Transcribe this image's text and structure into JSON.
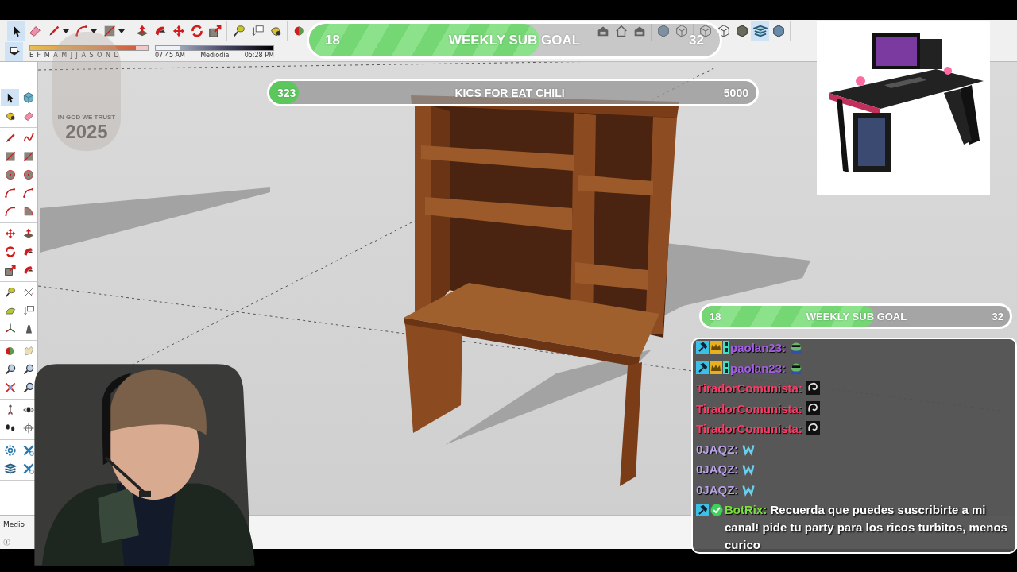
{
  "top_toolbar": {
    "left_groups": [
      {
        "tools": [
          {
            "kind": "select",
            "selected": true,
            "menu": false
          },
          {
            "kind": "eraser",
            "selected": false,
            "menu": false
          },
          {
            "kind": "pencil",
            "selected": false,
            "menu": true
          },
          {
            "kind": "arc",
            "selected": false,
            "menu": true
          },
          {
            "kind": "rectangle",
            "selected": false,
            "menu": true
          }
        ]
      },
      {
        "tools": [
          {
            "kind": "pushpull",
            "selected": false,
            "menu": false
          },
          {
            "kind": "followme",
            "selected": false,
            "menu": false
          },
          {
            "kind": "move",
            "selected": false,
            "menu": false
          },
          {
            "kind": "rotate",
            "selected": false,
            "menu": false
          },
          {
            "kind": "scale",
            "selected": false,
            "menu": false
          }
        ]
      },
      {
        "tools": [
          {
            "kind": "tape",
            "selected": false,
            "menu": false
          },
          {
            "kind": "text",
            "selected": false,
            "menu": false
          },
          {
            "kind": "paint",
            "selected": false,
            "menu": false
          }
        ]
      },
      {
        "tools": [
          {
            "kind": "orbit",
            "selected": false,
            "menu": false
          }
        ]
      }
    ],
    "right_groups": [
      {
        "tools": [
          {
            "kind": "warehouse",
            "selected": false,
            "menu": false
          },
          {
            "kind": "house",
            "selected": false,
            "menu": false
          },
          {
            "kind": "warehouse",
            "selected": false,
            "menu": false
          }
        ]
      },
      {
        "tools": [
          {
            "kind": "cube",
            "selected": false,
            "menu": false
          },
          {
            "kind": "cube-outline",
            "selected": false,
            "menu": false
          }
        ]
      },
      {
        "tools": [
          {
            "kind": "cube-outline",
            "selected": false,
            "menu": false
          },
          {
            "kind": "cube-outline",
            "selected": false,
            "menu": false
          },
          {
            "kind": "cube-grey",
            "selected": false,
            "menu": false
          },
          {
            "kind": "layers",
            "selected": true,
            "menu": false
          },
          {
            "kind": "cube",
            "selected": false,
            "menu": false
          }
        ]
      }
    ]
  },
  "shadow_bar": {
    "shadows_on": true,
    "months": "E F M A M J J A S O N D",
    "month_slider": {
      "level": 0.9
    },
    "time_slider": {
      "level": 0.2
    },
    "time_start": "07:45 AM",
    "time_mid": "Mediodía",
    "time_end": "05:28 PM"
  },
  "tool_palette": {
    "groups": [
      {
        "tools": [
          {
            "kind": "select",
            "selected": true
          },
          {
            "kind": "component",
            "selected": false
          },
          {
            "kind": "paint",
            "selected": false
          },
          {
            "kind": "eraser",
            "selected": false
          }
        ]
      },
      {
        "tools": [
          {
            "kind": "pencil",
            "selected": false
          },
          {
            "kind": "freehand",
            "selected": false
          },
          {
            "kind": "rectangle",
            "selected": false
          },
          {
            "kind": "rectangle",
            "selected": false
          },
          {
            "kind": "circle",
            "selected": false
          },
          {
            "kind": "circle",
            "selected": false
          },
          {
            "kind": "arc",
            "selected": false
          },
          {
            "kind": "arc",
            "selected": false
          },
          {
            "kind": "arc",
            "selected": false
          },
          {
            "kind": "pie",
            "selected": false
          }
        ]
      },
      {
        "tools": [
          {
            "kind": "move",
            "selected": false
          },
          {
            "kind": "pushpull",
            "selected": false
          },
          {
            "kind": "rotate",
            "selected": false
          },
          {
            "kind": "followme",
            "selected": false
          },
          {
            "kind": "scale",
            "selected": false
          },
          {
            "kind": "followme",
            "selected": false
          }
        ]
      },
      {
        "tools": [
          {
            "kind": "tape",
            "selected": false
          },
          {
            "kind": "dimension",
            "selected": false
          },
          {
            "kind": "protractor",
            "selected": false
          },
          {
            "kind": "text",
            "selected": false
          },
          {
            "kind": "axes",
            "selected": false
          },
          {
            "kind": "text3d",
            "selected": false
          }
        ]
      },
      {
        "tools": [
          {
            "kind": "orbit",
            "selected": false
          },
          {
            "kind": "hand",
            "selected": false
          },
          {
            "kind": "zoom",
            "selected": false
          },
          {
            "kind": "zoom",
            "selected": false
          },
          {
            "kind": "zoomext",
            "selected": false
          },
          {
            "kind": "zoom",
            "selected": false
          }
        ]
      },
      {
        "tools": [
          {
            "kind": "walk",
            "selected": false
          },
          {
            "kind": "eye",
            "selected": false
          },
          {
            "kind": "footprints",
            "selected": false
          },
          {
            "kind": "crosshair",
            "selected": false
          }
        ]
      },
      {
        "tools": [
          {
            "kind": "gear",
            "selected": false
          },
          {
            "kind": "xsection",
            "selected": false
          },
          {
            "kind": "layers",
            "selected": false
          },
          {
            "kind": "xsection",
            "selected": false
          }
        ]
      }
    ]
  },
  "status_bar": {
    "text": "Medio"
  },
  "stream_logo": {
    "line_1": "IN GOD WE TRUST",
    "line_2": "2025"
  },
  "sub_goal_top": {
    "title": "WEEKLY SUB GOAL",
    "current": "18",
    "target": "32",
    "level": 0.56
  },
  "kics_goal": {
    "title": "KICS FOR EAT CHILI",
    "current": "323",
    "target": "5000",
    "level": 0.06
  },
  "sub_goal_side": {
    "title": "WEEKLY SUB GOAL",
    "current": "18",
    "target": "32",
    "level": 0.56
  },
  "chat": {
    "messages": [
      {
        "user": "paolan23:",
        "color": "#a45ee5",
        "badges": [
          {
            "kind": "mod"
          },
          {
            "kind": "vip"
          },
          {
            "kind": "og"
          }
        ],
        "emotes": [
          {
            "kind": "sunglasses"
          }
        ]
      },
      {
        "user": "paolan23:",
        "color": "#a45ee5",
        "badges": [
          {
            "kind": "mod"
          },
          {
            "kind": "vip"
          },
          {
            "kind": "og"
          }
        ],
        "emotes": [
          {
            "kind": "sunglasses"
          }
        ]
      },
      {
        "user": "TiradorComunista:",
        "color": "#ff3a66",
        "emotes": [
          {
            "kind": "swirl"
          }
        ]
      },
      {
        "user": "TiradorComunista:",
        "color": "#ff3a66",
        "emotes": [
          {
            "kind": "swirl"
          }
        ]
      },
      {
        "user": "TiradorComunista:",
        "color": "#ff3a66",
        "emotes": [
          {
            "kind": "swirl"
          }
        ]
      },
      {
        "user": "0JAQZ:",
        "color": "#b8a2e3",
        "emotes": [
          {
            "kind": "w"
          }
        ]
      },
      {
        "user": "0JAQZ:",
        "color": "#b8a2e3",
        "emotes": [
          {
            "kind": "w"
          }
        ]
      },
      {
        "user": "0JAQZ:",
        "color": "#b8a2e3",
        "emotes": [
          {
            "kind": "w"
          }
        ]
      },
      {
        "user": "BotRix:",
        "color": "#7be03c",
        "badges": [
          {
            "kind": "mod"
          },
          {
            "kind": "verified"
          }
        ],
        "text": "Recuerda que puedes suscribirte a mi canal! pide tu party para los ricos turbitos, menos curico"
      }
    ]
  }
}
